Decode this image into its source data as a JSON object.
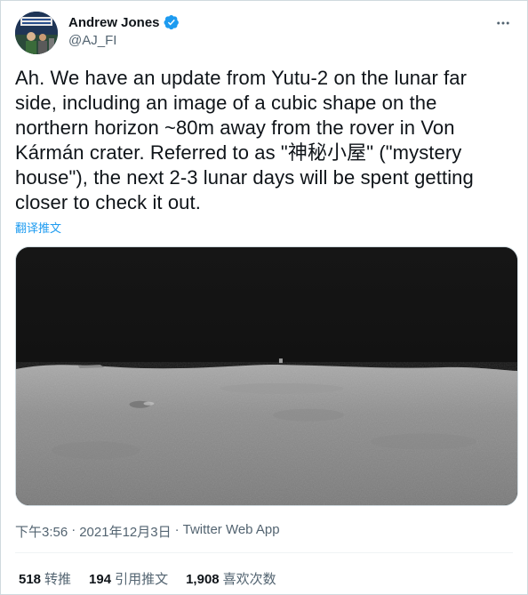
{
  "author": {
    "display_name": "Andrew Jones",
    "handle": "@AJ_FI",
    "verified": true
  },
  "tweet": {
    "text": "Ah. We have an update from Yutu-2 on the lunar far side, including an image of a cubic shape on the northern horizon ~80m away from the rover in Von Kármán crater. Referred to as \"神秘小屋\" (\"mystery house\"), the next 2-3 lunar days will be spent getting closer to check it out.",
    "translate_label": "翻译推文"
  },
  "meta": {
    "time": "下午3:56",
    "separator1": "·",
    "date": "2021年12月3日",
    "separator2": "·",
    "app": "Twitter Web App"
  },
  "stats": {
    "retweets": {
      "count": "518",
      "label": "转推"
    },
    "quotes": {
      "count": "194",
      "label": "引用推文"
    },
    "likes": {
      "count": "1,908",
      "label": "喜欢次数"
    }
  },
  "icons": {
    "verified": "verified-badge-icon",
    "more": "more-options-icon"
  },
  "colors": {
    "accent": "#1d9bf0",
    "text_primary": "#0f1419",
    "text_secondary": "#536471"
  }
}
